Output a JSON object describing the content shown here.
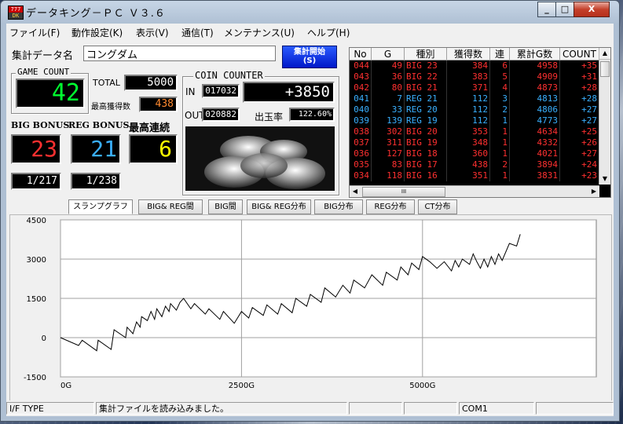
{
  "window": {
    "title": "データキング－ＰＣ Ｖ３.６",
    "minimize_label": "_",
    "maximize_label": "□",
    "close_label": "X"
  },
  "menu": [
    "ファイル(F)",
    "動作設定(K)",
    "表示(V)",
    "通信(T)",
    "メンテナンス(U)",
    "ヘルプ(H)"
  ],
  "summary": {
    "data_name_label": "集計データ名",
    "data_name_value": "コングダム",
    "start_button": "集計開始\n(S)",
    "game_count_label": "GAME COUNT",
    "game_count": "42",
    "total_label": "TOTAL",
    "total_value": "5000",
    "max_gain_label": "最高獲得数",
    "max_gain_value": "438",
    "big_label": "BIG BONUS",
    "big_value": "23",
    "reg_label": "REG BONUS",
    "reg_value": "21",
    "max_streak_label": "最高連続",
    "max_streak_value": "6",
    "big_prob": "1/217",
    "reg_prob": "1/238"
  },
  "coin_counter": {
    "label": "COIN COUNTER",
    "in_label": "IN",
    "in_value": "017032",
    "diff": "+3850",
    "out_label": "OUT",
    "out_value": "020882",
    "payout_label": "出玉率",
    "payout_value": "122.60%"
  },
  "history_table": {
    "headers": [
      "No",
      "G",
      "種別",
      "獲得数",
      "連",
      "累計G数",
      "COUNT"
    ],
    "rows": [
      {
        "no": "044",
        "g": "49",
        "type": "BIG 23",
        "gain": "384",
        "streak": "6",
        "cum": "4958",
        "count": "+35",
        "kind": "big"
      },
      {
        "no": "043",
        "g": "36",
        "type": "BIG 22",
        "gain": "383",
        "streak": "5",
        "cum": "4909",
        "count": "+31",
        "kind": "big"
      },
      {
        "no": "042",
        "g": "80",
        "type": "BIG 21",
        "gain": "371",
        "streak": "4",
        "cum": "4873",
        "count": "+28",
        "kind": "big"
      },
      {
        "no": "041",
        "g": "7",
        "type": "REG 21",
        "gain": "112",
        "streak": "3",
        "cum": "4813",
        "count": "+28",
        "kind": "reg"
      },
      {
        "no": "040",
        "g": "33",
        "type": "REG 20",
        "gain": "112",
        "streak": "2",
        "cum": "4806",
        "count": "+27",
        "kind": "reg"
      },
      {
        "no": "039",
        "g": "139",
        "type": "REG 19",
        "gain": "112",
        "streak": "1",
        "cum": "4773",
        "count": "+27",
        "kind": "reg"
      },
      {
        "no": "038",
        "g": "302",
        "type": "BIG 20",
        "gain": "353",
        "streak": "1",
        "cum": "4634",
        "count": "+25",
        "kind": "big"
      },
      {
        "no": "037",
        "g": "311",
        "type": "BIG 19",
        "gain": "348",
        "streak": "1",
        "cum": "4332",
        "count": "+26",
        "kind": "big"
      },
      {
        "no": "036",
        "g": "127",
        "type": "BIG 18",
        "gain": "360",
        "streak": "1",
        "cum": "4021",
        "count": "+27",
        "kind": "big"
      },
      {
        "no": "035",
        "g": "83",
        "type": "BIG 17",
        "gain": "438",
        "streak": "2",
        "cum": "3894",
        "count": "+24",
        "kind": "big"
      },
      {
        "no": "034",
        "g": "118",
        "type": "BIG 16",
        "gain": "351",
        "streak": "1",
        "cum": "3831",
        "count": "+23",
        "kind": "big"
      }
    ],
    "hscroll_thumb": "III"
  },
  "tabs": [
    "スランプグラフ",
    "BIG& REG間",
    "BIG間",
    "BIG& REG分布",
    "BIG分布",
    "REG分布",
    "CT分布"
  ],
  "colors": {
    "big": "#ff3030",
    "reg": "#3ab0ff",
    "game_count": "#00ff30",
    "max_gain": "#ff8a30",
    "streak": "#ffff00",
    "lcd_text": "#ffffff"
  },
  "chart_data": {
    "type": "line",
    "title": "",
    "xlabel": "",
    "ylabel": "",
    "x_ticks": [
      "0G",
      "2500G",
      "5000G"
    ],
    "y_ticks": [
      "4500",
      "3000",
      "1500",
      "0",
      "-1500"
    ],
    "xlim": [
      0,
      7400
    ],
    "ylim": [
      -1500,
      4500
    ],
    "grid": true,
    "x": [
      0,
      250,
      300,
      500,
      520,
      700,
      740,
      900,
      920,
      1000,
      1050,
      1100,
      1120,
      1200,
      1250,
      1300,
      1330,
      1400,
      1450,
      1500,
      1520,
      1600,
      1650,
      1700,
      1800,
      1850,
      2000,
      2050,
      2200,
      2250,
      2400,
      2500,
      2600,
      2650,
      2800,
      2850,
      3000,
      3050,
      3200,
      3250,
      3400,
      3450,
      3600,
      3650,
      3800,
      3900,
      4000,
      4050,
      4200,
      4300,
      4450,
      4500,
      4650,
      4700,
      4800,
      4850,
      4950,
      5000,
      5100,
      5200,
      5300,
      5400,
      5450,
      5500,
      5550,
      5650,
      5700,
      5750,
      5800,
      5850,
      5900,
      5950,
      6000,
      6050,
      6100,
      6200,
      6300,
      6350
    ],
    "y": [
      0,
      -300,
      -100,
      -500,
      -100,
      -450,
      300,
      0,
      400,
      150,
      600,
      400,
      800,
      650,
      1000,
      700,
      1100,
      800,
      1200,
      1000,
      1300,
      1050,
      1350,
      1500,
      1100,
      1300,
      900,
      1100,
      700,
      1000,
      550,
      1000,
      750,
      1150,
      850,
      1250,
      900,
      1300,
      950,
      1500,
      1200,
      1650,
      1350,
      1900,
      1550,
      2000,
      1700,
      2200,
      1900,
      2400,
      2000,
      2500,
      2200,
      2700,
      2400,
      2850,
      2600,
      3100,
      2900,
      2650,
      2900,
      2550,
      2950,
      2700,
      3000,
      2800,
      3200,
      2900,
      2650,
      3000,
      2700,
      3100,
      2800,
      3200,
      2950,
      3600,
      3500,
      3950
    ]
  },
  "status": {
    "if_label": "I/F TYPE",
    "message": "集計ファイルを読み込みました。",
    "port": "COM1"
  }
}
